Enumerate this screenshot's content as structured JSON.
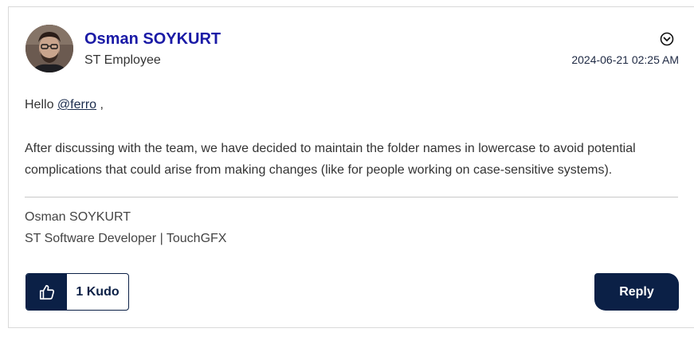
{
  "post": {
    "author": {
      "name": "Osman SOYKURT",
      "rank": "ST Employee"
    },
    "timestamp": "2024-06-21 02:25 AM",
    "body": {
      "greeting_prefix": "Hello ",
      "mention": "@ferro",
      "greeting_suffix": " ,",
      "paragraph_line1": "After discussing with the team, we have decided to maintain the folder names in lowercase to avoid potential",
      "paragraph_line2": "complications that could arise from making changes (like for people working on case-sensitive systems)."
    },
    "signature": {
      "line1": "Osman SOYKURT",
      "line2": "ST Software Developer | TouchGFX"
    },
    "actions": {
      "kudo_label": "1 Kudo",
      "reply_label": "Reply"
    }
  },
  "icons": {
    "options": "chevron-down-circle-icon",
    "kudo": "thumbs-up-icon"
  },
  "colors": {
    "author_name": "#1a1aa6",
    "button_bg": "#0b2046",
    "button_text": "#ffffff"
  }
}
